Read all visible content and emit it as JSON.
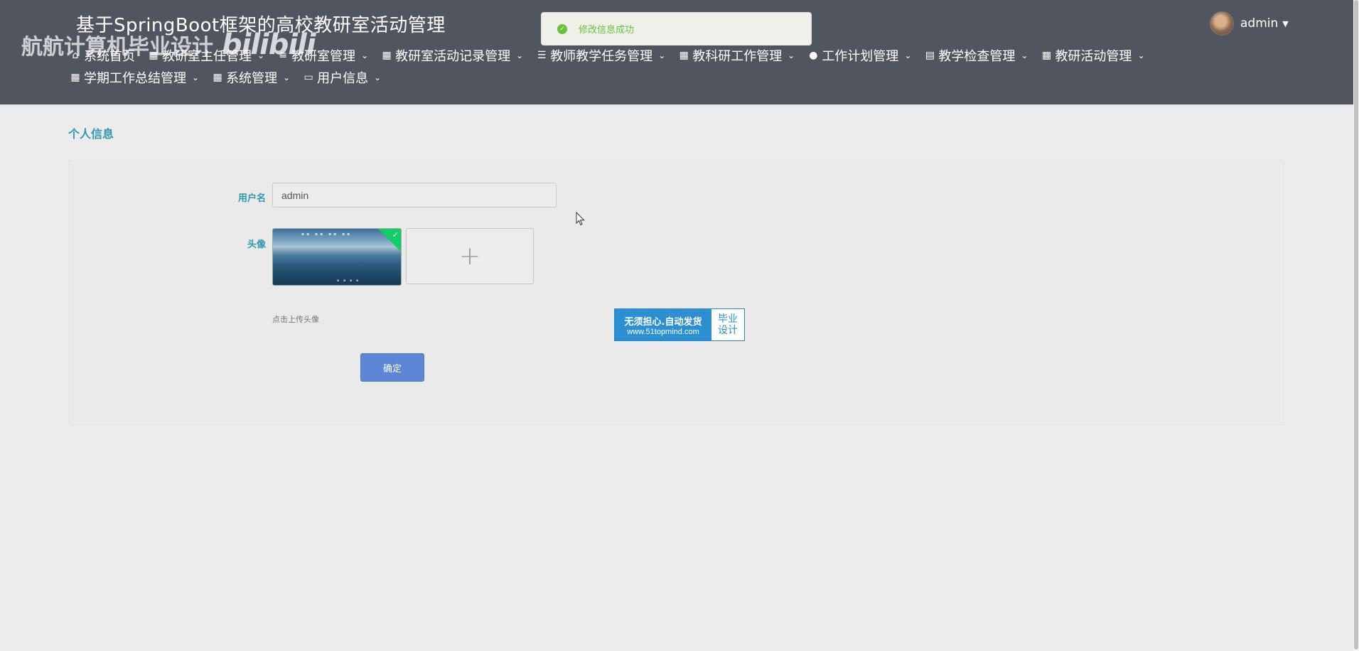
{
  "header": {
    "app_title": "基于SpringBoot框架的高校教研室活动管理",
    "watermark_text": "航航计算机毕业设计",
    "watermark_logo": "bilibili",
    "user_name": "admin"
  },
  "nav": {
    "items": [
      {
        "label": "系统首页",
        "icon": "home-icon",
        "has_caret": false
      },
      {
        "label": "教研室主任管理",
        "icon": "grid-icon",
        "has_caret": true
      },
      {
        "label": "教研室管理",
        "icon": "menu-icon",
        "has_caret": true
      },
      {
        "label": "教研室活动记录管理",
        "icon": "grid-icon",
        "has_caret": true
      },
      {
        "label": "教师教学任务管理",
        "icon": "list-icon",
        "has_caret": true
      },
      {
        "label": "教科研工作管理",
        "icon": "grid-icon",
        "has_caret": true
      },
      {
        "label": "工作计划管理",
        "icon": "user-icon",
        "has_caret": true
      },
      {
        "label": "教学检查管理",
        "icon": "clipboard-icon",
        "has_caret": true
      },
      {
        "label": "教研活动管理",
        "icon": "grid-icon",
        "has_caret": true
      },
      {
        "label": "学期工作总结管理",
        "icon": "grid-icon",
        "has_caret": true
      },
      {
        "label": "系统管理",
        "icon": "grid-icon",
        "has_caret": true
      },
      {
        "label": "用户信息",
        "icon": "card-icon",
        "has_caret": true
      }
    ]
  },
  "toast": {
    "message": "修改信息成功",
    "icon": "success-icon",
    "color": "#67c23a"
  },
  "page": {
    "title": "个人信息"
  },
  "form": {
    "username_label": "用户名",
    "username_value": "admin",
    "avatar_label": "头像",
    "upload_hint": "点击上传头像",
    "submit_label": "确定"
  },
  "ad": {
    "line1": "无须担心.自动发货",
    "line2": "www.51topmind.com",
    "right_top": "毕业",
    "right_bottom": "设计"
  },
  "colors": {
    "header_bg": "#50555f",
    "accent": "#2e99ad",
    "primary_button": "#5b87d6"
  }
}
